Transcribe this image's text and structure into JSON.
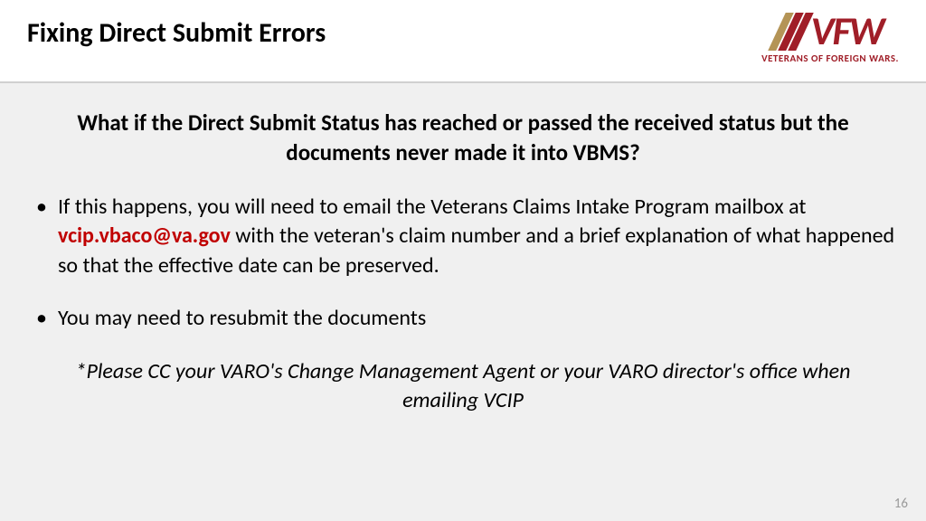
{
  "header": {
    "title": "Fixing Direct Submit Errors",
    "logo_text": "VFW",
    "tagline": "VETERANS OF FOREIGN WARS."
  },
  "content": {
    "question": "What if the Direct Submit Status has reached or passed the received status but the documents never made it into VBMS?",
    "bullet1_before": "If this happens, you will need to email the Veterans Claims Intake Program mailbox at ",
    "bullet1_email": "vcip.vbaco@va.gov",
    "bullet1_after": " with the veteran's claim number and a brief explanation of what happened so that the effective date can be preserved.",
    "bullet2": "You may need to resubmit the documents",
    "note": "*Please CC your VARO's Change Management Agent or your VARO director's office when emailing VCIP"
  },
  "page_number": "16"
}
